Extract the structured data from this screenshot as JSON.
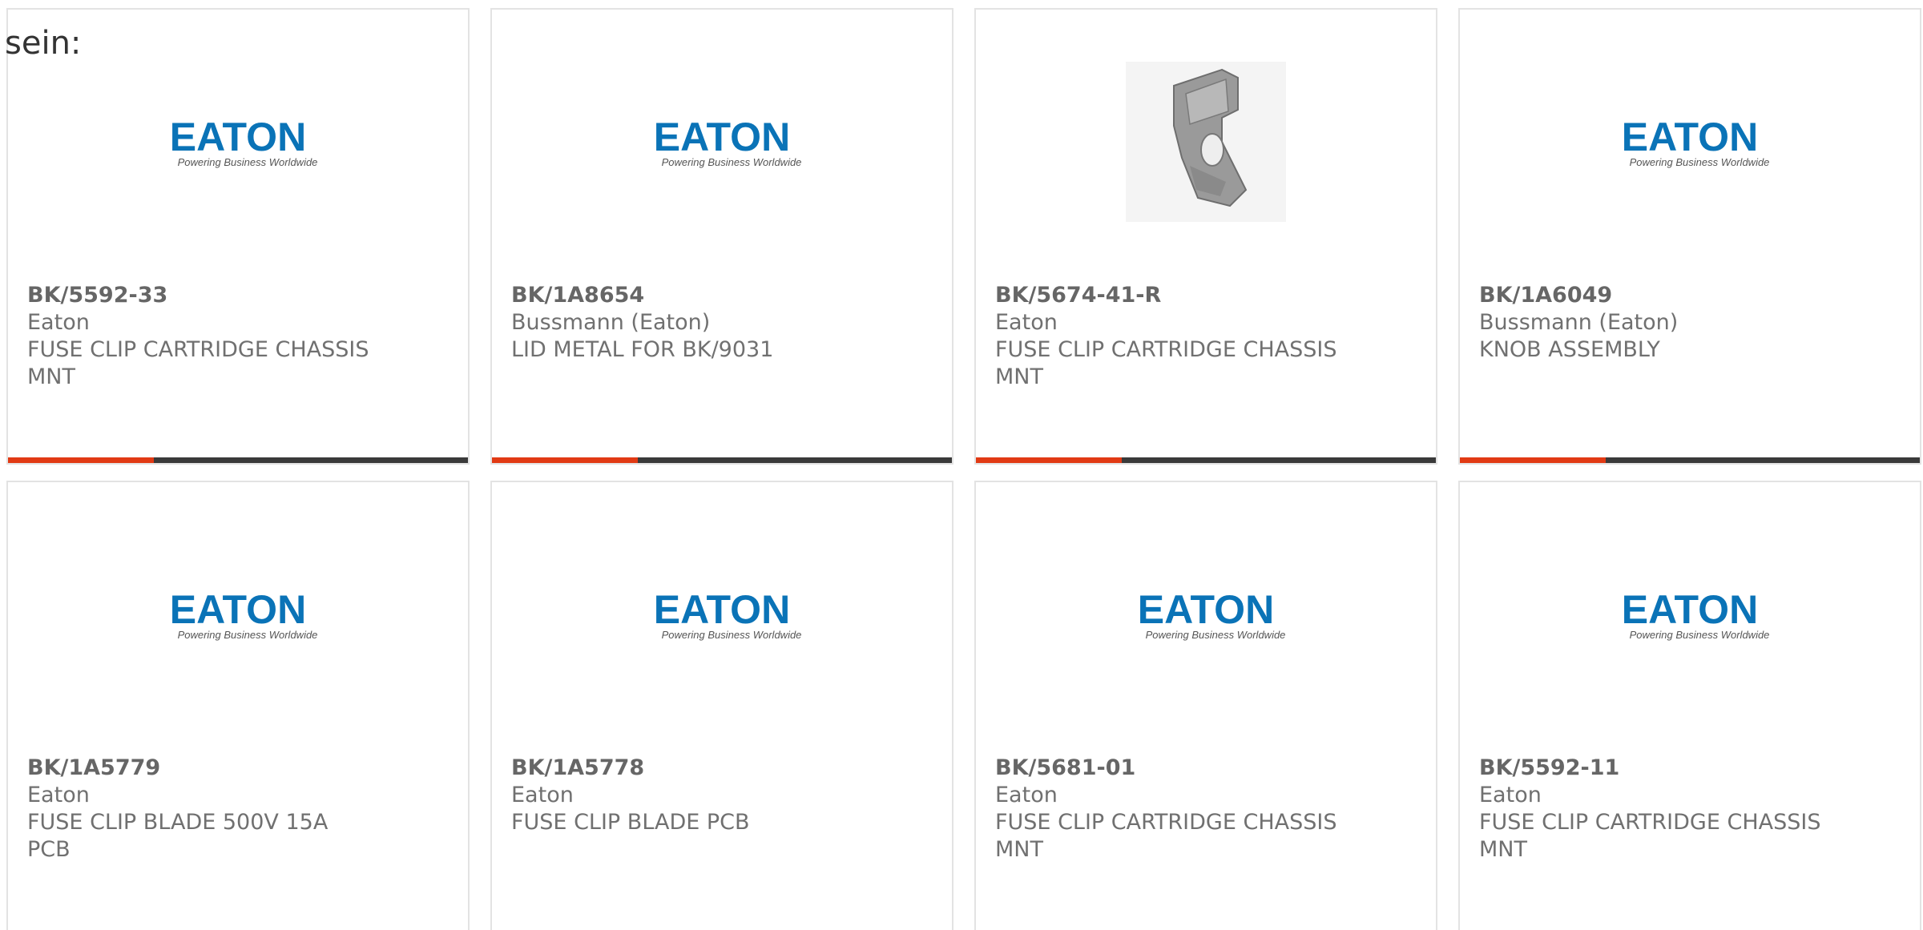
{
  "intro_text": "sein:",
  "logo": {
    "brand_text": "EATON",
    "tagline": "Powering Business Worldwide",
    "brand_color": "#0a73b7"
  },
  "colors": {
    "accent": "#e13a14",
    "bar": "#3a3a3a",
    "text": "#707070",
    "border": "#e3e3e3"
  },
  "products": [
    {
      "part_number": "BK/5592-33",
      "manufacturer": "Eaton",
      "description": "FUSE CLIP CARTRIDGE CHASSIS MNT",
      "image": "eaton-logo"
    },
    {
      "part_number": "BK/1A8654",
      "manufacturer": "Bussmann (Eaton)",
      "description": "LID METAL FOR BK/9031",
      "image": "eaton-logo"
    },
    {
      "part_number": "BK/5674-41-R",
      "manufacturer": "Eaton",
      "description": "FUSE CLIP CARTRIDGE CHASSIS MNT",
      "image": "fuse-clip-photo"
    },
    {
      "part_number": "BK/1A6049",
      "manufacturer": "Bussmann (Eaton)",
      "description": "KNOB ASSEMBLY",
      "image": "eaton-logo"
    },
    {
      "part_number": "BK/1A5779",
      "manufacturer": "Eaton",
      "description": "FUSE CLIP BLADE 500V 15A PCB",
      "image": "eaton-logo"
    },
    {
      "part_number": "BK/1A5778",
      "manufacturer": "Eaton",
      "description": "FUSE CLIP BLADE PCB",
      "image": "eaton-logo"
    },
    {
      "part_number": "BK/5681-01",
      "manufacturer": "Eaton",
      "description": "FUSE CLIP CARTRIDGE CHASSIS MNT",
      "image": "eaton-logo"
    },
    {
      "part_number": "BK/5592-11",
      "manufacturer": "Eaton",
      "description": "FUSE CLIP CARTRIDGE CHASSIS MNT",
      "image": "eaton-logo"
    }
  ]
}
